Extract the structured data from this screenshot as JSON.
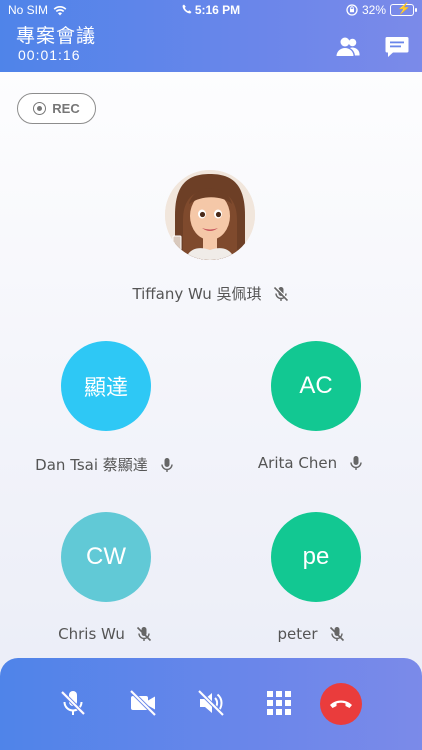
{
  "status_bar": {
    "carrier": "No SIM",
    "time": "5:16 PM",
    "battery": "32%"
  },
  "header": {
    "title": "專案會議",
    "timer": "00:01:16"
  },
  "rec_label": "REC",
  "host": {
    "name": "Tiffany Wu 吳佩琪",
    "mic_muted": true
  },
  "participants": [
    {
      "initials": "顯達",
      "name": "Dan Tsai 蔡顯達",
      "color": "#2ec8f5",
      "mic_muted": false
    },
    {
      "initials": "AC",
      "name": "Arita Chen",
      "color": "#12c892",
      "mic_muted": false
    },
    {
      "initials": "CW",
      "name": "Chris Wu",
      "color": "#61c9d6",
      "mic_muted": true
    },
    {
      "initials": "pe",
      "name": "peter",
      "color": "#12c892",
      "mic_muted": true
    }
  ],
  "controls": [
    "mic-muted-icon",
    "video-off-icon",
    "speaker-muted-icon",
    "keypad-icon",
    "end-call-icon"
  ]
}
